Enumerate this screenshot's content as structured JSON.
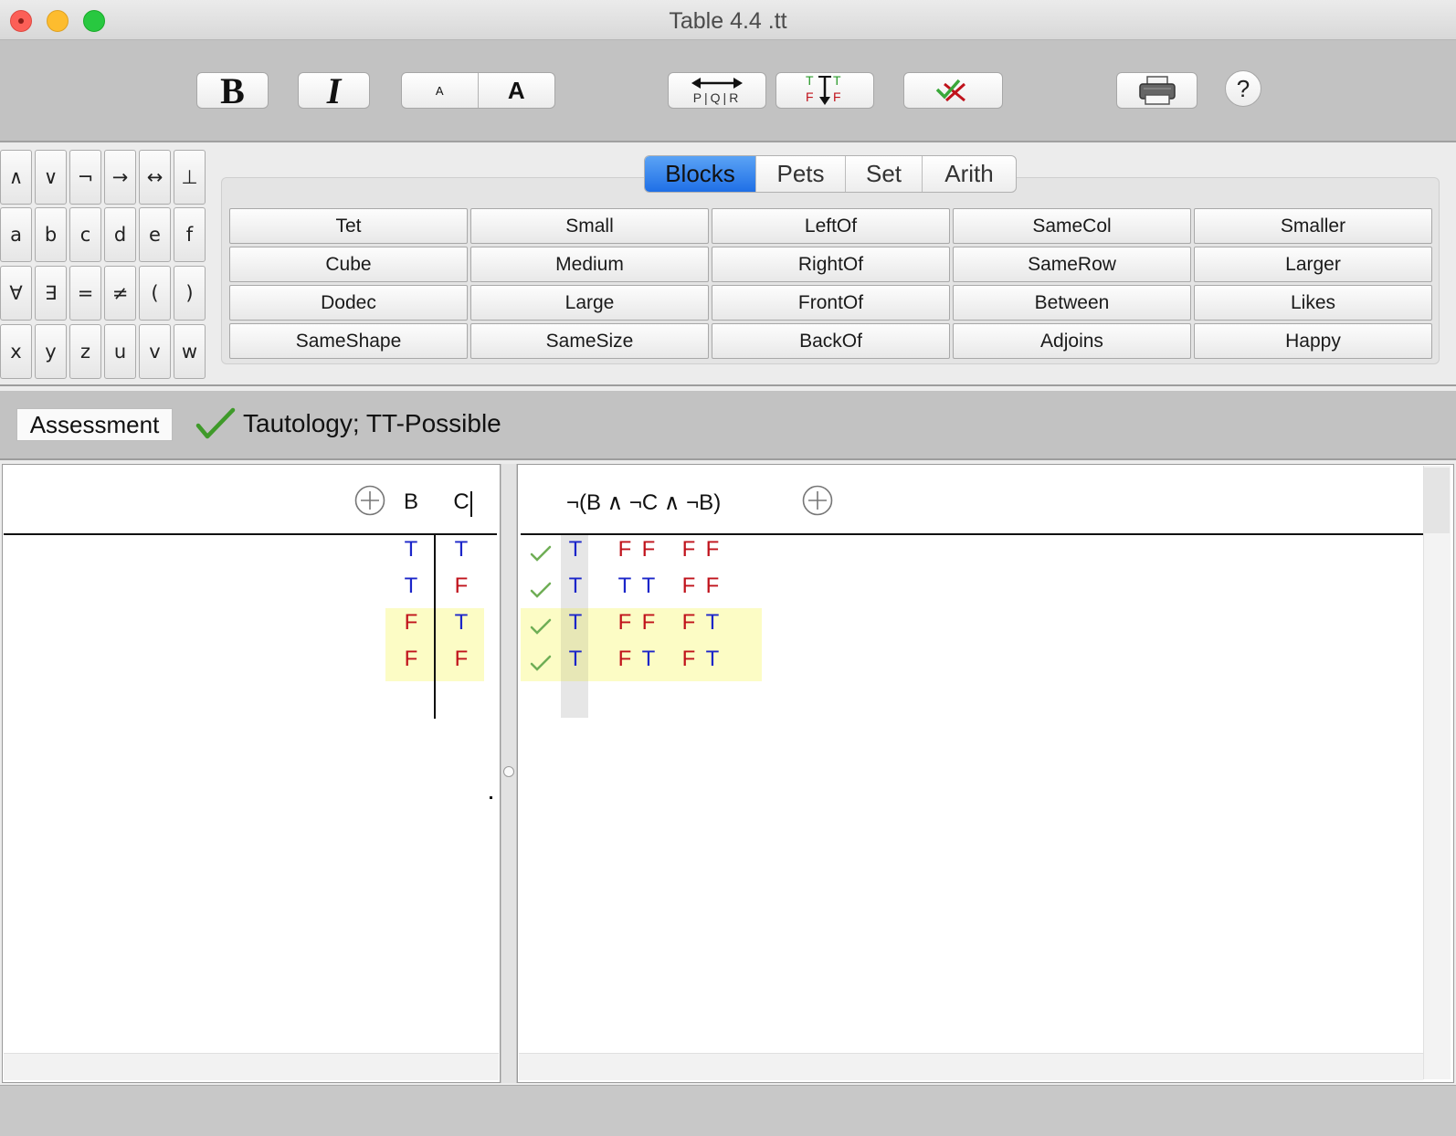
{
  "window": {
    "title": "Table 4.4 .tt"
  },
  "toolbar": {
    "bold_label": "B",
    "italic_label": "I",
    "font_small_label": "A",
    "font_large_label": "A",
    "help_label": "?",
    "add_column_icon_letters": "P|Q|R",
    "fill_column_icon_letters": {
      "left_top": "T",
      "left_bottom": "F",
      "right_top": "T",
      "right_bottom": "F"
    }
  },
  "keypad": {
    "rows": [
      [
        "∧",
        "∨",
        "¬",
        "→",
        "↔",
        "⊥"
      ],
      [
        "a",
        "b",
        "c",
        "d",
        "e",
        "f"
      ],
      [
        "∀",
        "∃",
        "=",
        "≠",
        "(",
        ")"
      ],
      [
        "x",
        "y",
        "z",
        "u",
        "v",
        "w"
      ]
    ]
  },
  "predicate_tabs": [
    "Blocks",
    "Pets",
    "Set",
    "Arith"
  ],
  "active_tab": "Blocks",
  "predicates": [
    [
      "Tet",
      "Small",
      "LeftOf",
      "SameCol",
      "Smaller"
    ],
    [
      "Cube",
      "Medium",
      "RightOf",
      "SameRow",
      "Larger"
    ],
    [
      "Dodec",
      "Large",
      "FrontOf",
      "Between",
      "Likes"
    ],
    [
      "SameShape",
      "SameSize",
      "BackOf",
      "Adjoins",
      "Happy"
    ]
  ],
  "assessment": {
    "button_label": "Assessment",
    "result_text": "Tautology; TT-Possible"
  },
  "reference_table": {
    "headers": [
      "B",
      "C"
    ],
    "rows": [
      [
        "T",
        "T"
      ],
      [
        "T",
        "F"
      ],
      [
        "F",
        "T"
      ],
      [
        "F",
        "F"
      ]
    ]
  },
  "formula_table": {
    "formula": "¬(B ∧ ¬C ∧ ¬B)",
    "rows": [
      [
        "T",
        "F",
        "F",
        "F",
        "F"
      ],
      [
        "T",
        "T",
        "T",
        "F",
        "F"
      ],
      [
        "T",
        "F",
        "F",
        "F",
        "T"
      ],
      [
        "T",
        "F",
        "T",
        "F",
        "T"
      ]
    ]
  },
  "colors": {
    "true": "#1b25c9",
    "false": "#c0121b",
    "highlight": "#fcfcc5",
    "active_tab": "#1f6fe6"
  }
}
